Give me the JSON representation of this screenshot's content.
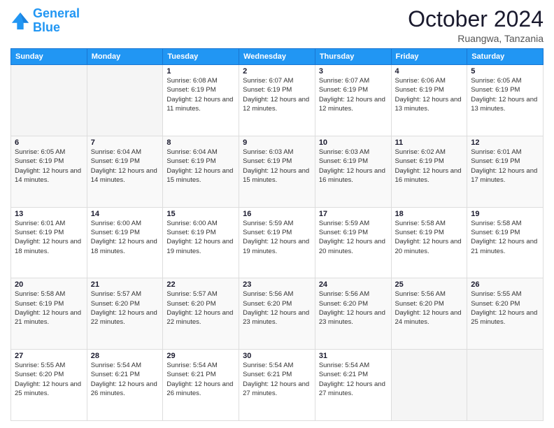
{
  "logo": {
    "line1": "General",
    "line2": "Blue"
  },
  "title": "October 2024",
  "location": "Ruangwa, Tanzania",
  "days_header": [
    "Sunday",
    "Monday",
    "Tuesday",
    "Wednesday",
    "Thursday",
    "Friday",
    "Saturday"
  ],
  "weeks": [
    [
      {
        "day": "",
        "detail": ""
      },
      {
        "day": "",
        "detail": ""
      },
      {
        "day": "1",
        "detail": "Sunrise: 6:08 AM\nSunset: 6:19 PM\nDaylight: 12 hours and 11 minutes."
      },
      {
        "day": "2",
        "detail": "Sunrise: 6:07 AM\nSunset: 6:19 PM\nDaylight: 12 hours and 12 minutes."
      },
      {
        "day": "3",
        "detail": "Sunrise: 6:07 AM\nSunset: 6:19 PM\nDaylight: 12 hours and 12 minutes."
      },
      {
        "day": "4",
        "detail": "Sunrise: 6:06 AM\nSunset: 6:19 PM\nDaylight: 12 hours and 13 minutes."
      },
      {
        "day": "5",
        "detail": "Sunrise: 6:05 AM\nSunset: 6:19 PM\nDaylight: 12 hours and 13 minutes."
      }
    ],
    [
      {
        "day": "6",
        "detail": "Sunrise: 6:05 AM\nSunset: 6:19 PM\nDaylight: 12 hours and 14 minutes."
      },
      {
        "day": "7",
        "detail": "Sunrise: 6:04 AM\nSunset: 6:19 PM\nDaylight: 12 hours and 14 minutes."
      },
      {
        "day": "8",
        "detail": "Sunrise: 6:04 AM\nSunset: 6:19 PM\nDaylight: 12 hours and 15 minutes."
      },
      {
        "day": "9",
        "detail": "Sunrise: 6:03 AM\nSunset: 6:19 PM\nDaylight: 12 hours and 15 minutes."
      },
      {
        "day": "10",
        "detail": "Sunrise: 6:03 AM\nSunset: 6:19 PM\nDaylight: 12 hours and 16 minutes."
      },
      {
        "day": "11",
        "detail": "Sunrise: 6:02 AM\nSunset: 6:19 PM\nDaylight: 12 hours and 16 minutes."
      },
      {
        "day": "12",
        "detail": "Sunrise: 6:01 AM\nSunset: 6:19 PM\nDaylight: 12 hours and 17 minutes."
      }
    ],
    [
      {
        "day": "13",
        "detail": "Sunrise: 6:01 AM\nSunset: 6:19 PM\nDaylight: 12 hours and 18 minutes."
      },
      {
        "day": "14",
        "detail": "Sunrise: 6:00 AM\nSunset: 6:19 PM\nDaylight: 12 hours and 18 minutes."
      },
      {
        "day": "15",
        "detail": "Sunrise: 6:00 AM\nSunset: 6:19 PM\nDaylight: 12 hours and 19 minutes."
      },
      {
        "day": "16",
        "detail": "Sunrise: 5:59 AM\nSunset: 6:19 PM\nDaylight: 12 hours and 19 minutes."
      },
      {
        "day": "17",
        "detail": "Sunrise: 5:59 AM\nSunset: 6:19 PM\nDaylight: 12 hours and 20 minutes."
      },
      {
        "day": "18",
        "detail": "Sunrise: 5:58 AM\nSunset: 6:19 PM\nDaylight: 12 hours and 20 minutes."
      },
      {
        "day": "19",
        "detail": "Sunrise: 5:58 AM\nSunset: 6:19 PM\nDaylight: 12 hours and 21 minutes."
      }
    ],
    [
      {
        "day": "20",
        "detail": "Sunrise: 5:58 AM\nSunset: 6:19 PM\nDaylight: 12 hours and 21 minutes."
      },
      {
        "day": "21",
        "detail": "Sunrise: 5:57 AM\nSunset: 6:20 PM\nDaylight: 12 hours and 22 minutes."
      },
      {
        "day": "22",
        "detail": "Sunrise: 5:57 AM\nSunset: 6:20 PM\nDaylight: 12 hours and 22 minutes."
      },
      {
        "day": "23",
        "detail": "Sunrise: 5:56 AM\nSunset: 6:20 PM\nDaylight: 12 hours and 23 minutes."
      },
      {
        "day": "24",
        "detail": "Sunrise: 5:56 AM\nSunset: 6:20 PM\nDaylight: 12 hours and 23 minutes."
      },
      {
        "day": "25",
        "detail": "Sunrise: 5:56 AM\nSunset: 6:20 PM\nDaylight: 12 hours and 24 minutes."
      },
      {
        "day": "26",
        "detail": "Sunrise: 5:55 AM\nSunset: 6:20 PM\nDaylight: 12 hours and 25 minutes."
      }
    ],
    [
      {
        "day": "27",
        "detail": "Sunrise: 5:55 AM\nSunset: 6:20 PM\nDaylight: 12 hours and 25 minutes."
      },
      {
        "day": "28",
        "detail": "Sunrise: 5:54 AM\nSunset: 6:21 PM\nDaylight: 12 hours and 26 minutes."
      },
      {
        "day": "29",
        "detail": "Sunrise: 5:54 AM\nSunset: 6:21 PM\nDaylight: 12 hours and 26 minutes."
      },
      {
        "day": "30",
        "detail": "Sunrise: 5:54 AM\nSunset: 6:21 PM\nDaylight: 12 hours and 27 minutes."
      },
      {
        "day": "31",
        "detail": "Sunrise: 5:54 AM\nSunset: 6:21 PM\nDaylight: 12 hours and 27 minutes."
      },
      {
        "day": "",
        "detail": ""
      },
      {
        "day": "",
        "detail": ""
      }
    ]
  ]
}
